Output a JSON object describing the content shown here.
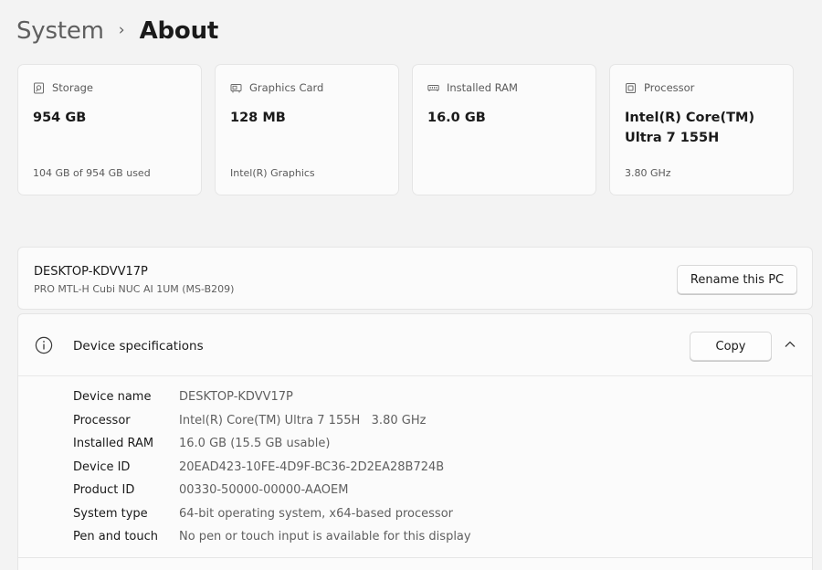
{
  "breadcrumb": {
    "parent": "System",
    "separator": "›",
    "current": "About"
  },
  "cards": [
    {
      "icon": "storage-icon",
      "title": "Storage",
      "value": "954 GB",
      "sub": "104 GB of 954 GB used"
    },
    {
      "icon": "graphics-card-icon",
      "title": "Graphics Card",
      "value": "128 MB",
      "sub": "Intel(R) Graphics"
    },
    {
      "icon": "ram-icon",
      "title": "Installed RAM",
      "value": "16.0 GB",
      "sub": ""
    },
    {
      "icon": "processor-icon",
      "title": "Processor",
      "value": "Intel(R) Core(TM) Ultra 7 155H",
      "sub": "3.80 GHz"
    }
  ],
  "pc": {
    "name": "DESKTOP-KDVV17P",
    "model": "PRO MTL-H Cubi NUC AI 1UM (MS-B209)",
    "rename_label": "Rename this PC"
  },
  "specs": {
    "title": "Device specifications",
    "copy_label": "Copy",
    "rows": [
      {
        "label": "Device name",
        "value": "DESKTOP-KDVV17P"
      },
      {
        "label": "Processor",
        "value": "Intel(R) Core(TM) Ultra 7 155H   3.80 GHz"
      },
      {
        "label": "Installed RAM",
        "value": "16.0 GB (15.5 GB usable)"
      },
      {
        "label": "Device ID",
        "value": "20EAD423-10FE-4D9F-BC36-2D2EA28B724B"
      },
      {
        "label": "Product ID",
        "value": "00330-50000-00000-AAOEM"
      },
      {
        "label": "System type",
        "value": "64-bit operating system, x64-based processor"
      },
      {
        "label": "Pen and touch",
        "value": "No pen or touch input is available for this display"
      }
    ]
  },
  "colors": {
    "background": "#f3f3f3",
    "card": "#fbfbfb",
    "text_primary": "#1a1a1a",
    "text_secondary": "#5f5f5f"
  }
}
